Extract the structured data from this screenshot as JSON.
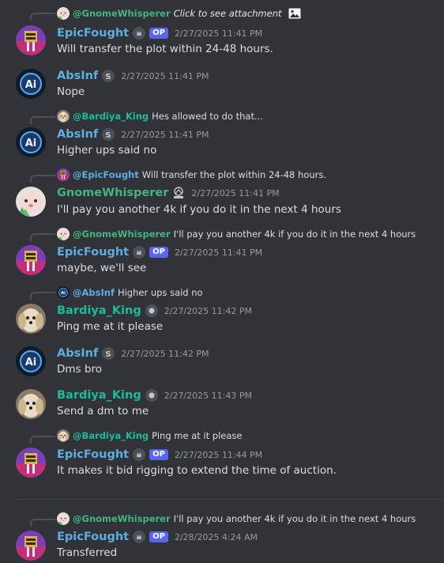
{
  "colors": {
    "background": "#313338",
    "epicfought": "#5dade2",
    "absinf": "#5dade2",
    "gnomewhisperer": "#43b581",
    "bardiya_king": "#1abc9c",
    "op_badge": "#5865f2"
  },
  "messages": [
    {
      "user": "EpicFought",
      "op": "OP",
      "timestamp": "2/27/2025 11:41 PM",
      "text": "Will transfer the plot within 24-48 hours.",
      "reply": {
        "mention": "@GnomeWhisperer",
        "text": "Click to see attachment",
        "icon": "image-icon"
      }
    },
    {
      "user": "AbsInf",
      "timestamp": "2/27/2025 11:41 PM",
      "text": "Nope"
    },
    {
      "user": "AbsInf",
      "timestamp": "2/27/2025 11:41 PM",
      "text": "Higher ups said no",
      "reply": {
        "mention": "@Bardiya_King",
        "text": "Hes allowed to do that..."
      }
    },
    {
      "user": "GnomeWhisperer",
      "timestamp": "2/27/2025 11:41 PM",
      "text": "I'll pay you another 4k if you do it in the next 4 hours",
      "reply": {
        "mention": "@EpicFought",
        "text": "Will transfer the plot within 24-48 hours."
      }
    },
    {
      "user": "EpicFought",
      "op": "OP",
      "timestamp": "2/27/2025 11:41 PM",
      "text": "maybe, we'll see",
      "reply": {
        "mention": "@GnomeWhisperer",
        "text": "I'll pay you another 4k if you do it in the next 4 hours"
      }
    },
    {
      "user": "Bardiya_King",
      "timestamp": "2/27/2025 11:42 PM",
      "text": "Ping me at it please",
      "reply": {
        "mention": "@AbsInf",
        "text": "Higher ups said no"
      }
    },
    {
      "user": "AbsInf",
      "timestamp": "2/27/2025 11:42 PM",
      "text": "Dms bro"
    },
    {
      "user": "Bardiya_King",
      "timestamp": "2/27/2025 11:43 PM",
      "text": "Send a dm to me"
    },
    {
      "user": "EpicFought",
      "op": "OP",
      "timestamp": "2/27/2025 11:44 PM",
      "text": "It makes it bid rigging to extend the time of auction.",
      "reply": {
        "mention": "@Bardiya_King",
        "text": "Ping me at it please"
      }
    },
    {
      "user": "EpicFought",
      "op": "OP",
      "timestamp": "2/28/2025 4:24 AM",
      "text": "Transferred",
      "reply": {
        "mention": "@GnomeWhisperer",
        "text": "I'll pay you another 4k if you do it in the next 4 hours"
      }
    }
  ]
}
